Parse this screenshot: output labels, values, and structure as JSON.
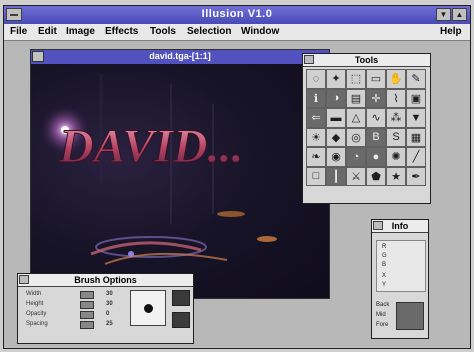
{
  "app": {
    "title": "Illusion V1.0"
  },
  "menu": {
    "items": [
      "File",
      "Edit",
      "Image",
      "Effects",
      "Tools",
      "Selection",
      "Window",
      "Help"
    ]
  },
  "document": {
    "title": "david.tga-[1:1]",
    "artwork_text": "DAVID..."
  },
  "tools_palette": {
    "title": "Tools",
    "icons": [
      "lasso-icon",
      "wand-icon",
      "marquee-icon",
      "select-icon",
      "hand-icon",
      "pencil-icon",
      "info-icon",
      "contrast-icon",
      "gradient-icon",
      "crosshair-icon",
      "brush-icon",
      "stamp-icon",
      "arrow-left-icon",
      "eraser-icon",
      "sharpen-icon",
      "smudge-icon",
      "spray-icon",
      "fill-icon",
      "bulb-icon",
      "drop-icon",
      "blur-icon",
      "text-b-icon",
      "text-s-icon",
      "swatch-icon",
      "feather-icon",
      "target-icon",
      "dodge-icon",
      "burn-icon",
      "sponge-icon",
      "line-icon",
      "rect-icon",
      "pipe-icon",
      "knife-icon",
      "poly-icon",
      "star-icon",
      "pen-icon"
    ]
  },
  "info_palette": {
    "title": "Info",
    "rows": [
      "R",
      "G",
      "B",
      "X",
      "Y"
    ],
    "footer_labels": [
      "Back",
      "Mid",
      "Fore"
    ]
  },
  "brush_palette": {
    "title": "Brush Options",
    "rows": [
      {
        "label": "Width",
        "value": "30"
      },
      {
        "label": "Height",
        "value": "30"
      },
      {
        "label": "Opacity",
        "value": "0"
      },
      {
        "label": "Spacing",
        "value": "25"
      }
    ]
  }
}
